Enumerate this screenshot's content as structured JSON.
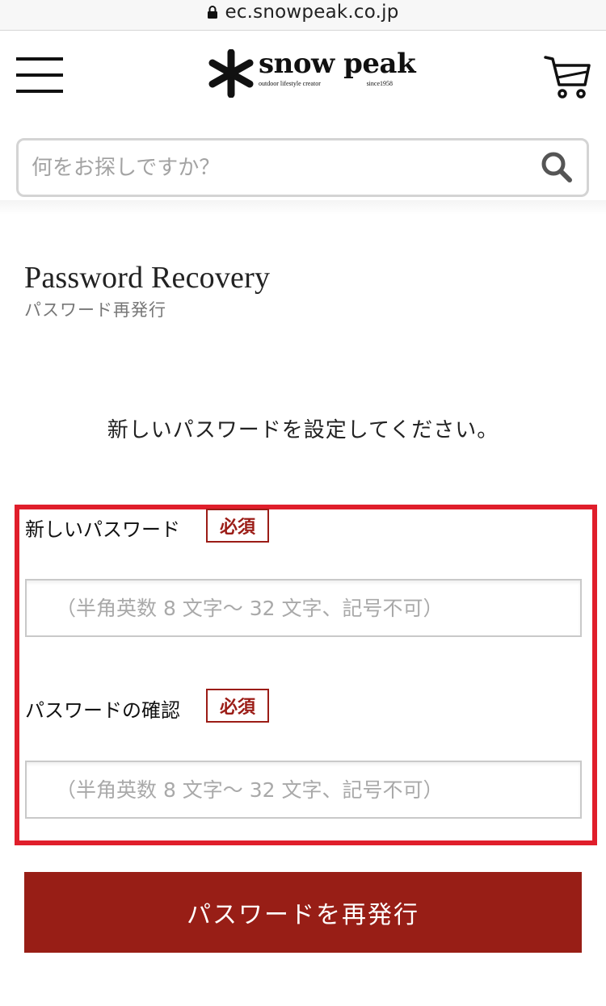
{
  "browser": {
    "url": "ec.snowpeak.co.jp",
    "lock_icon": "lock-icon"
  },
  "header": {
    "menu_icon": "hamburger-menu-icon",
    "logo": {
      "name": "snow peak",
      "tagline": "outdoor lifestyle creator",
      "since": "since1958",
      "mark_icon": "snowflake-asterisk-icon"
    },
    "cart_icon": "shopping-cart-icon"
  },
  "search": {
    "placeholder": "何をお探しですか？",
    "icon": "search-icon"
  },
  "page": {
    "title": "Password Recovery",
    "subtitle": "パスワード再発行",
    "instruction": "新しいパスワードを設定してください。"
  },
  "form": {
    "new_password": {
      "label": "新しいパスワード",
      "required": "必須",
      "placeholder": "（半角英数 8 文字～ 32 文字、記号不可）"
    },
    "confirm_password": {
      "label": "パスワードの確認",
      "required": "必須",
      "placeholder": "（半角英数 8 文字～ 32 文字、記号不可）"
    },
    "submit_label": "パスワードを再発行"
  },
  "colors": {
    "accent": "#981e16",
    "highlight_border": "#e01e2b",
    "required_badge": "#9b1c16"
  }
}
